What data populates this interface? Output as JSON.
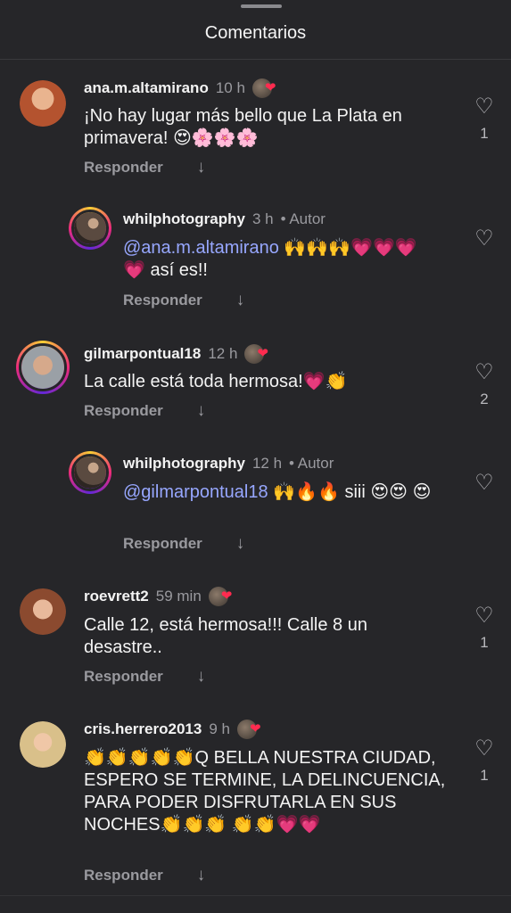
{
  "header": {
    "title": "Comentarios"
  },
  "reply_label": "Responder",
  "comments": [
    {
      "username": "ana.m.altamirano",
      "time": "10 h",
      "text": "¡No hay lugar más bello que La Plata en primavera! 😍🌸🌸🌸",
      "likes": "1"
    },
    {
      "username": "whilphotography",
      "time": "3 h",
      "author": "• Autor",
      "mention": "@ana.m.altamirano",
      "text": " 🙌🙌🙌💗💗💗 💗 así es!!",
      "likes": ""
    },
    {
      "username": "gilmarpontual18",
      "time": "12 h",
      "text": "La calle está toda hermosa!💗👏",
      "likes": "2"
    },
    {
      "username": "whilphotography",
      "time": "12 h",
      "author": "• Autor",
      "mention": "@gilmarpontual18",
      "text": " 🙌🔥🔥 siii 😍😍 😍",
      "likes": ""
    },
    {
      "username": "roevrett2",
      "time": "59 min",
      "text": "Calle 12, está hermosa!!! Calle 8 un desastre..",
      "likes": "1"
    },
    {
      "username": "cris.herrero2013",
      "time": "9 h",
      "text": "👏👏👏👏👏Q BELLA NUESTRA CIUDAD, ESPERO SE TERMINE, LA DELINCUENCIA, PARA PODER DISFRUTARLA EN SUS NOCHES👏👏👏 👏👏💗💗",
      "likes": "1"
    }
  ]
}
